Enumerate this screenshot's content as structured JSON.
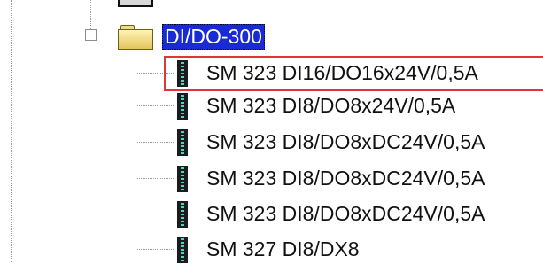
{
  "folder": {
    "label": "DI/DO-300"
  },
  "modules": [
    {
      "label": "SM 323 DI16/DO16x24V/0,5A",
      "highlighted": true
    },
    {
      "label": "SM 323 DI8/DO8x24V/0,5A"
    },
    {
      "label": "SM 323 DI8/DO8xDC24V/0,5A"
    },
    {
      "label": "SM 323 DI8/DO8xDC24V/0,5A"
    },
    {
      "label": "SM 323 DI8/DO8xDC24V/0,5A"
    },
    {
      "label": "SM 327 DI8/DX8"
    }
  ],
  "colors": {
    "selection": "#1a2bd6",
    "highlight_border": "#e0363b",
    "tree_lines": "#9a9a9a"
  }
}
